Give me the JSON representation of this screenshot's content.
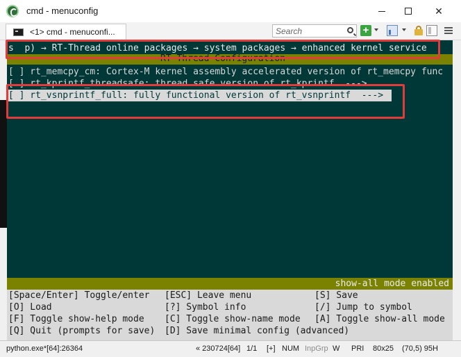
{
  "window": {
    "title": "cmd - menuconfig"
  },
  "tabbar": {
    "tab_label": "<1> cmd - menuconfi...",
    "search_placeholder": "Search",
    "add_glyph": "+"
  },
  "terminal": {
    "breadcrumb": "s  p) → RT-Thread online packages → system packages → enhanced kernel service",
    "banner": "RT-Thread Configuration",
    "items": [
      "[ ] rt_memcpy_cm: Cortex-M kernel assembly accelerated version of rt_memcpy func",
      "[ ] rt_kprintf_threadsafe: thread safe version of rt_kprintf  --->",
      "[ ] rt_vsnprintf_full: fully functional version of rt_vsnprintf  --->"
    ],
    "mode_status": "show-all mode enabled",
    "help": [
      [
        "[Space/Enter] Toggle/enter",
        "[ESC] Leave menu",
        "[S] Save"
      ],
      [
        "[O] Load",
        "[?] Symbol info",
        "[/] Jump to symbol"
      ],
      [
        "[F] Toggle show-help mode",
        "[C] Toggle show-name mode",
        "[A] Toggle show-all mode"
      ],
      [
        "[Q] Quit (prompts for save)",
        "[D] Save minimal config (advanced)",
        ""
      ]
    ]
  },
  "statusbar": {
    "process": "python.exe*[64]:26364",
    "position": "« 230724[64]",
    "page": "1/1",
    "plus": "[+]",
    "num": "NUM",
    "inpgrp": "InpGrp",
    "w": "W",
    "pri": "PRI",
    "size": "80x25",
    "cursor": "(70,5) 95H"
  },
  "colors": {
    "terminal_bg": "#003838",
    "banner_bg": "#7a8200",
    "selection_bg": "#d9d9d9",
    "highlight": "#e23b3b"
  }
}
